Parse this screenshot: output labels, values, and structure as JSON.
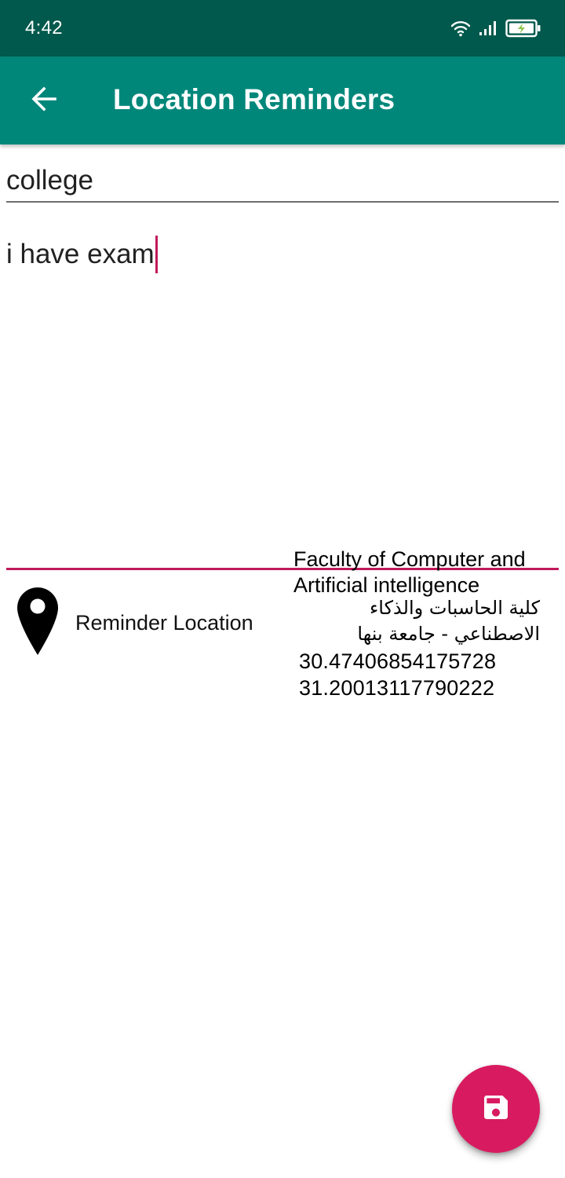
{
  "status_bar": {
    "time": "4:42",
    "icons": [
      "wifi-icon",
      "signal-icon",
      "battery-charging-icon"
    ]
  },
  "app_bar": {
    "back_icon": "arrow-back-icon",
    "title": "Location Reminders"
  },
  "form": {
    "title_value": "college",
    "description_value": "i have exam"
  },
  "location": {
    "pin_icon": "location-pin-icon",
    "label": "Reminder Location",
    "place_name": "Faculty of Computer and Artificial intelligence",
    "place_name_ar": "كلية الحاسبات والذكاء الاصطناعي - جامعة بنها",
    "latitude": "30.47406854175728",
    "longitude": "31.20013117790222"
  },
  "fab": {
    "icon": "save-icon"
  },
  "colors": {
    "status_bar": "#00594c",
    "primary": "#00877a",
    "accent": "#d81b60",
    "focused_underline": "#c2185b"
  }
}
